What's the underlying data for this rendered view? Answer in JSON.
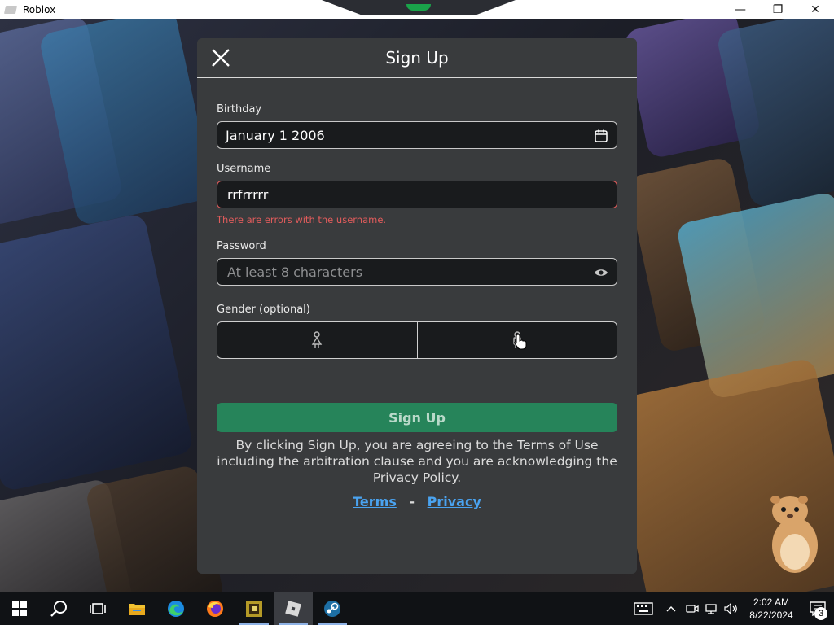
{
  "window": {
    "title": "Roblox",
    "minimize": "—",
    "maximize": "❐",
    "close": "✕"
  },
  "modal": {
    "title": "Sign Up",
    "birthday": {
      "label": "Birthday",
      "value": "January 1 2006"
    },
    "username": {
      "label": "Username",
      "value": "rrfrrrrr",
      "error": "There are errors with the username."
    },
    "password": {
      "label": "Password",
      "placeholder": "At least 8 characters",
      "value": ""
    },
    "gender": {
      "label": "Gender (optional)",
      "options": [
        "female",
        "male"
      ]
    },
    "signup_button": "Sign Up",
    "legal_text": "By clicking Sign Up, you are agreeing to the Terms of Use including the arbitration clause and you are acknowledging the Privacy Policy.",
    "links": {
      "terms": "Terms",
      "separator": "-",
      "privacy": "Privacy"
    }
  },
  "taskbar": {
    "apps": [
      "start-icon",
      "search-icon",
      "task-view-icon",
      "file-explorer-icon",
      "edge-icon",
      "firefox-icon",
      "game-icon",
      "roblox-icon",
      "steam-icon"
    ],
    "active_app": "roblox-icon",
    "time": "2:02 AM",
    "date": "8/22/2024",
    "notification_count": "3"
  },
  "colors": {
    "modal_bg": "#393b3d",
    "input_bg": "#191b1d",
    "error": "#e25c5c",
    "primary_button": "#26845a",
    "link": "#4aa3f0"
  }
}
